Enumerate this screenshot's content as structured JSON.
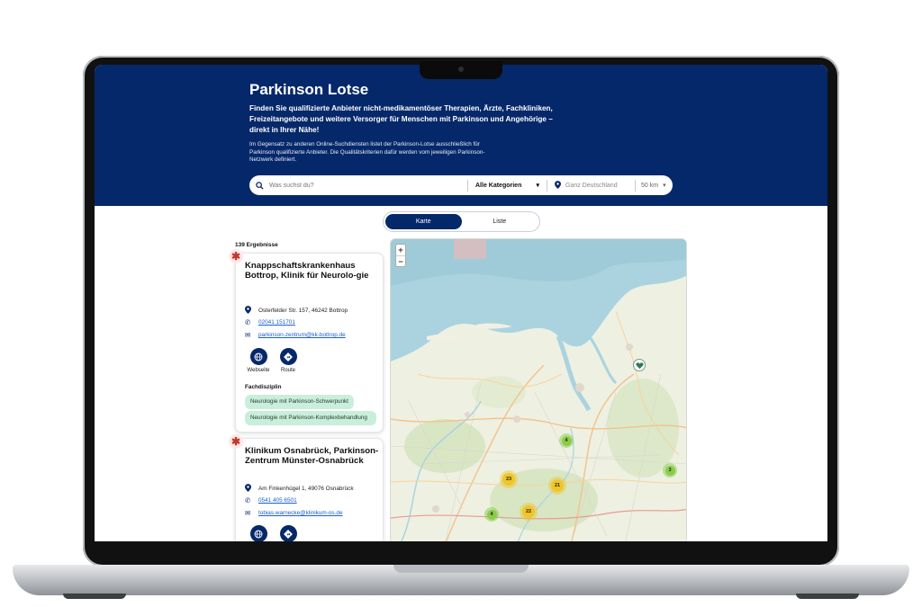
{
  "header": {
    "title": "Parkinson Lotse",
    "lead": "Finden Sie qualifizierte Anbieter nicht-medikamentöser Therapien, Ärzte, Fachkliniken, Freizeitangebote und weitere Versorger für Menschen mit Parkinson und Angehörige – direkt in Ihrer Nähe!",
    "sub": "Im Gegensatz zu anderen Online-Suchdiensten listet der Parkinson-Lotse ausschließlich für Parkinson qualifizierte Anbieter. Die Qualitätskriterien dafür werden vom jeweiligen Parkinson-Netzwerk definiert."
  },
  "search": {
    "placeholder": "Was suchst du?",
    "category": "Alle Kategorien",
    "location_placeholder": "Ganz Deutschland",
    "radius": "50 km"
  },
  "view_toggle": {
    "map": "Karte",
    "list": "Liste",
    "active": "map"
  },
  "results": {
    "count_label": "139 Ergebnisse"
  },
  "cards": [
    {
      "title": "Knappschaftskrankenhaus Bottrop, Klinik für Neurolo-gie",
      "address": "Osterfelder Str. 157, 46242 Bottrop",
      "phone": "02041 151701",
      "email": "parkinson-zentrum@kk-bottrop.de",
      "website_label": "Webseite",
      "route_label": "Route",
      "discipline_label": "Fachdisziplin",
      "tags": [
        "Neurologie mit Parkinson-Schwerpunkt",
        "Neurologie mit Parkinson-Komplexbehandlung"
      ]
    },
    {
      "title": "Klinikum Osnabrück, Parkinson-Zentrum Münster-Osnabrück",
      "address": "Am Finkenhügel 1, 49076 Osnabrück",
      "phone": "0541 405 6501",
      "email": "tobias.warnecke@klinikum-os.de"
    }
  ],
  "map": {
    "zoom_in": "+",
    "zoom_out": "−",
    "clusters": [
      "4",
      "23",
      "21",
      "3",
      "22",
      "4"
    ]
  },
  "colors": {
    "brand": "#05286a",
    "tag": "#c9efdb",
    "cluster_yellow": "#f0c52a",
    "cluster_green": "#8ccb4a"
  }
}
